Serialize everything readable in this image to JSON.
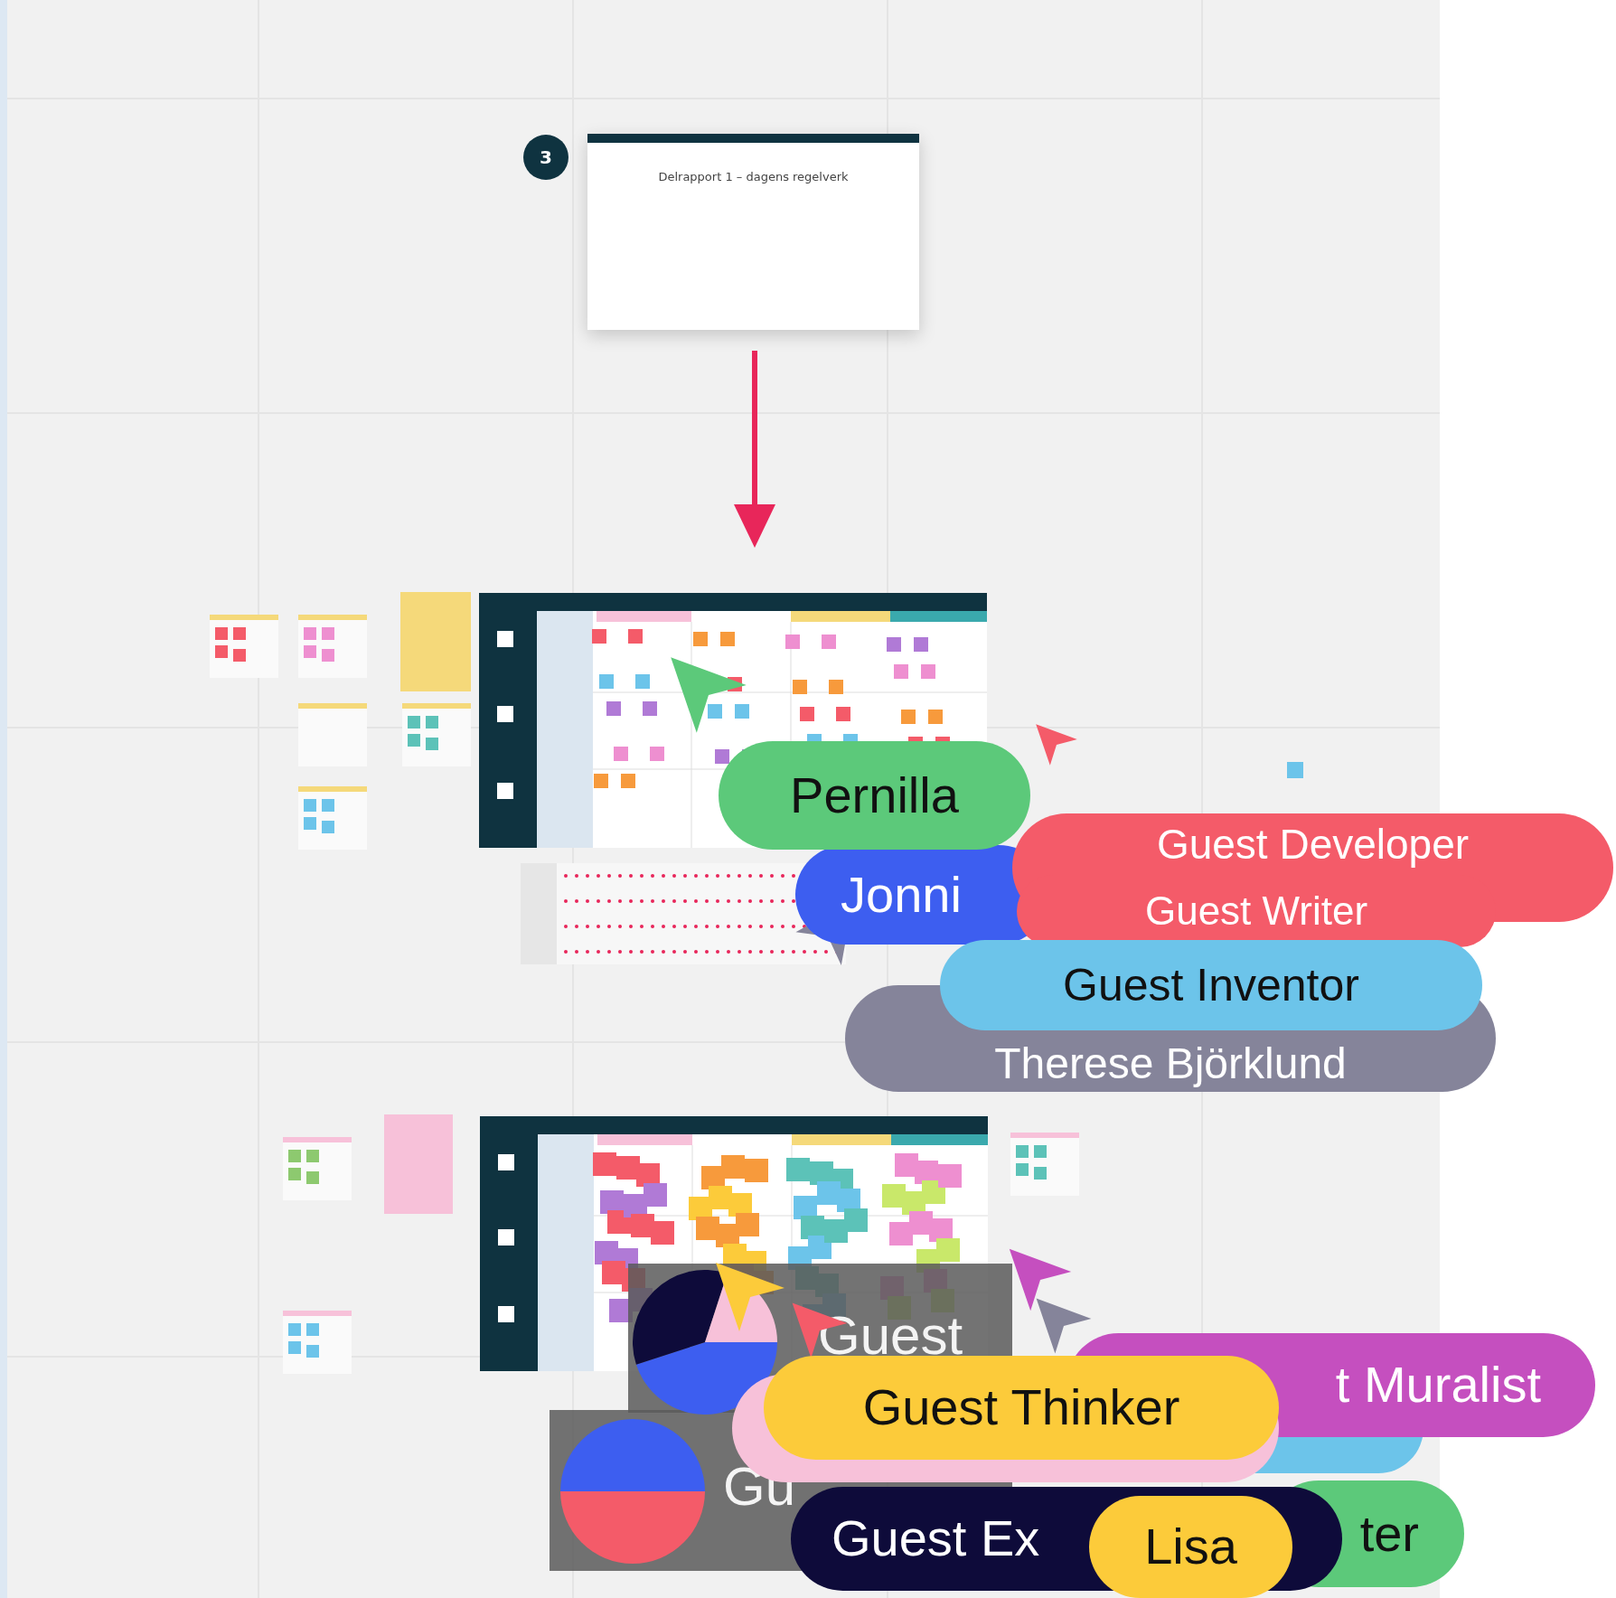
{
  "canvas": {
    "frame": {
      "number": "3",
      "title": "Delrapport 1 – dagens regelverk"
    },
    "overlay_texts": [
      "Guest",
      "Gu"
    ],
    "cursors": [
      {
        "name": "Pernilla",
        "color": "#5cc97a"
      },
      {
        "name": "Jonni",
        "color": "#3d5ef0"
      },
      {
        "name": "Guest Developer",
        "color": "#f45b69"
      },
      {
        "name": "Guest Writer",
        "color": "#f45b69"
      },
      {
        "name": "Guest Inventor",
        "color": "#6cc4ea"
      },
      {
        "name": "Therese Björklund",
        "color": "#85849a"
      },
      {
        "name": "t Muralist",
        "color": "#c54fbf"
      },
      {
        "name": "Guest Thinker",
        "color": "#fccb3a"
      },
      {
        "name": "Guest Ex",
        "color": "#0e0b3a"
      },
      {
        "name": "Lisa",
        "color": "#fccb3a"
      },
      {
        "name": "ter",
        "color": "#5cc97a"
      }
    ]
  }
}
